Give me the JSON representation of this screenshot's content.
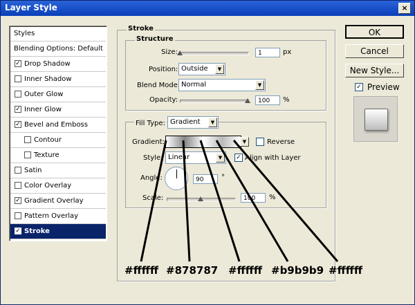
{
  "window": {
    "title": "Layer Style",
    "close_glyph": "×"
  },
  "styles_panel": {
    "header": "Styles",
    "items": [
      {
        "label": "Blending Options: Default",
        "has_checkbox": false,
        "checked": false,
        "indent": false,
        "selected": false
      },
      {
        "label": "Drop Shadow",
        "has_checkbox": true,
        "checked": true,
        "indent": false,
        "selected": false
      },
      {
        "label": "Inner Shadow",
        "has_checkbox": true,
        "checked": false,
        "indent": false,
        "selected": false
      },
      {
        "label": "Outer Glow",
        "has_checkbox": true,
        "checked": false,
        "indent": false,
        "selected": false
      },
      {
        "label": "Inner Glow",
        "has_checkbox": true,
        "checked": true,
        "indent": false,
        "selected": false
      },
      {
        "label": "Bevel and Emboss",
        "has_checkbox": true,
        "checked": true,
        "indent": false,
        "selected": false
      },
      {
        "label": "Contour",
        "has_checkbox": true,
        "checked": false,
        "indent": true,
        "selected": false
      },
      {
        "label": "Texture",
        "has_checkbox": true,
        "checked": false,
        "indent": true,
        "selected": false
      },
      {
        "label": "Satin",
        "has_checkbox": true,
        "checked": false,
        "indent": false,
        "selected": false
      },
      {
        "label": "Color Overlay",
        "has_checkbox": true,
        "checked": false,
        "indent": false,
        "selected": false
      },
      {
        "label": "Gradient Overlay",
        "has_checkbox": true,
        "checked": true,
        "indent": false,
        "selected": false
      },
      {
        "label": "Pattern Overlay",
        "has_checkbox": true,
        "checked": false,
        "indent": false,
        "selected": false
      },
      {
        "label": "Stroke",
        "has_checkbox": true,
        "checked": true,
        "indent": false,
        "selected": true
      }
    ]
  },
  "stroke": {
    "title": "Stroke",
    "structure": {
      "title": "Structure",
      "size_label": "Size:",
      "size_value": "1",
      "size_unit": "px",
      "size_fraction": 0.0,
      "position_label": "Position:",
      "position_value": "Outside",
      "blend_label": "Blend Mode:",
      "blend_value": "Normal",
      "opacity_label": "Opacity:",
      "opacity_value": "100",
      "opacity_unit": "%",
      "opacity_fraction": 1.0
    },
    "fill": {
      "fill_type_label": "Fill Type:",
      "fill_type_value": "Gradient",
      "gradient_label": "Gradient:",
      "gradient_stops": [
        "#ffffff",
        "#878787",
        "#ffffff",
        "#b9b9b9",
        "#ffffff"
      ],
      "reverse_label": "Reverse",
      "reverse_checked": false,
      "style_label": "Style:",
      "style_value": "Linear",
      "align_label": "Align with Layer",
      "align_checked": true,
      "angle_label": "Angle:",
      "angle_value": "90",
      "angle_unit": "°",
      "scale_label": "Scale:",
      "scale_value": "100",
      "scale_unit": "%",
      "scale_fraction": 0.5
    }
  },
  "buttons": {
    "ok": "OK",
    "cancel": "Cancel",
    "new_style": "New Style...",
    "preview_label": "Preview",
    "preview_checked": true
  },
  "annotations": [
    "#ffffff",
    "#878787",
    "#ffffff",
    "#b9b9b9",
    "#ffffff"
  ]
}
